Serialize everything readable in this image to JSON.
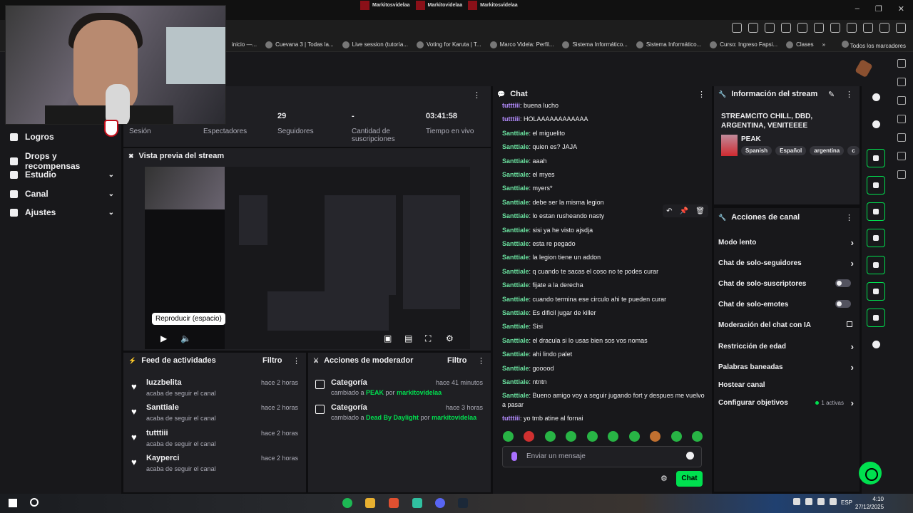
{
  "browser": {
    "tabs": [
      "Markitosvidelaa",
      "Markitovidelaa",
      "Markitosvidelaa"
    ],
    "bookmarks": [
      "inicio —...",
      "Cuevana 3 | Todas la...",
      "Live session (tutoría...",
      "Voting for Karuta | T...",
      "Marco Videla: Perfil...",
      "Sistema Informático...",
      "Sistema Informático...",
      "Curso: Ingreso Fapsi...",
      "Clases"
    ],
    "bookmarks_overflow": "»",
    "all_bookmarks": "Todos los marcadores"
  },
  "nav": {
    "items": [
      {
        "label": "Logros",
        "chev": ""
      },
      {
        "label": "Drops y recompensas",
        "chev": ""
      },
      {
        "label": "Estudio",
        "chev": "⌄"
      },
      {
        "label": "Canal",
        "chev": "⌄"
      },
      {
        "label": "Ajustes",
        "chev": "⌄"
      }
    ]
  },
  "stats": {
    "items": [
      {
        "value": "",
        "label": "Sesión"
      },
      {
        "value": "",
        "label": "Espectadores"
      },
      {
        "value": "29",
        "label": "Seguidores"
      },
      {
        "value": "-",
        "label": "Cantidad de suscripciones"
      },
      {
        "value": "03:41:58",
        "label": "Tiempo en vivo"
      }
    ]
  },
  "preview": {
    "title": "Vista previa del stream",
    "tooltip": "Reproducir (espacio)"
  },
  "feed": {
    "title": "Feed de actividades",
    "filter": "Filtro",
    "items": [
      {
        "name": "luzzbelita",
        "desc": "acaba de seguir el canal",
        "time": "hace 2 horas"
      },
      {
        "name": "Santtiale",
        "desc": "acaba de seguir el canal",
        "time": "hace 2 horas"
      },
      {
        "name": "tutttiii",
        "desc": "acaba de seguir el canal",
        "time": "hace 2 horas"
      },
      {
        "name": "Kayperci",
        "desc": "acaba de seguir el canal",
        "time": "hace 2 horas"
      }
    ]
  },
  "modactions": {
    "title": "Acciones de moderador",
    "filter": "Filtro",
    "items": [
      {
        "name": "Categoría",
        "pre": "cambiado a ",
        "game": "PEAK",
        "mid": " por ",
        "user": "markitovidelaa",
        "time": "hace 41 minutos"
      },
      {
        "name": "Categoría",
        "pre": "cambiado a ",
        "game": "Dead By Daylight",
        "mid": " por ",
        "user": "markitovidelaa",
        "time": "hace 3 horas"
      }
    ]
  },
  "chat": {
    "title": "Chat",
    "messages": [
      {
        "user": "tutttiii",
        "text": "buena lucho",
        "color": "#b48cff"
      },
      {
        "user": "tutttiii",
        "text": "HOLAAAAAAAAAAAA",
        "color": "#b48cff"
      },
      {
        "user": "Santtiale",
        "text": "el miguelito",
        "color": "#6be3a0"
      },
      {
        "user": "Santtiale",
        "text": "quien es? JAJA",
        "color": "#6be3a0"
      },
      {
        "user": "Santtiale",
        "text": "aaah",
        "color": "#6be3a0"
      },
      {
        "user": "Santtiale",
        "text": "el myes",
        "color": "#6be3a0"
      },
      {
        "user": "Santtiale",
        "text": "myers*",
        "color": "#6be3a0"
      },
      {
        "user": "Santtiale",
        "text": "debe ser la misma legion",
        "color": "#6be3a0"
      },
      {
        "user": "Santtiale",
        "text": "lo estan rusheando nasty",
        "color": "#6be3a0"
      },
      {
        "user": "Santtiale",
        "text": "sisi ya he visto ajsdja",
        "color": "#6be3a0"
      },
      {
        "user": "Santtiale",
        "text": "esta re pegado",
        "color": "#6be3a0"
      },
      {
        "user": "Santtiale",
        "text": "la legion tiene un addon",
        "color": "#6be3a0"
      },
      {
        "user": "Santtiale",
        "text": "q cuando te sacas el coso no te podes curar",
        "color": "#6be3a0"
      },
      {
        "user": "Santtiale",
        "text": "fijate a la derecha",
        "color": "#6be3a0"
      },
      {
        "user": "Santtiale",
        "text": "cuando termina ese circulo ahi te pueden curar",
        "color": "#6be3a0"
      },
      {
        "user": "Santtiale",
        "text": "Es dificil jugar de killer",
        "color": "#6be3a0"
      },
      {
        "user": "Santtiale",
        "text": "Sisi",
        "color": "#6be3a0"
      },
      {
        "user": "Santtiale",
        "text": "el dracula si lo usas bien sos vos nomas",
        "color": "#6be3a0"
      },
      {
        "user": "Santtiale",
        "text": "ahi lindo palet",
        "color": "#6be3a0"
      },
      {
        "user": "Santtiale",
        "text": "gooood",
        "color": "#6be3a0"
      },
      {
        "user": "Santtiale",
        "text": "ntntn",
        "color": "#6be3a0"
      },
      {
        "user": "Santtiale",
        "text": "Bueno amigo voy a seguir jugando fort y despues me vuelvo a pasar",
        "color": "#6be3a0"
      },
      {
        "user": "tutttiii",
        "text": "yo tmb atine al fornai",
        "color": "#b48cff"
      }
    ],
    "input_placeholder": "Enviar un mensaje",
    "send_label": "Chat"
  },
  "stream_info": {
    "title": "Información del stream",
    "stream_title": "STREAMCITO CHILL, DBD, ARGENTINA, VENITEEEE",
    "category": "PEAK",
    "tags": [
      "Spanish",
      "Español",
      "argentina",
      "c"
    ]
  },
  "channel_actions": {
    "title": "Acciones de canal",
    "items": [
      {
        "label": "Modo lento",
        "kind": "chevron"
      },
      {
        "label": "Chat de solo-seguidores",
        "kind": "chevron"
      },
      {
        "label": "Chat de solo-suscriptores",
        "kind": "toggle"
      },
      {
        "label": "Chat de solo-emotes",
        "kind": "toggle"
      },
      {
        "label": "Moderación del chat con IA",
        "kind": "external"
      },
      {
        "label": "Restricción de edad",
        "kind": "chevron"
      },
      {
        "label": "Palabras baneadas",
        "kind": "chevron"
      },
      {
        "label": "Hostear canal",
        "kind": "none"
      },
      {
        "label": "Configurar objetivos",
        "kind": "chevron",
        "note": "1 activas"
      }
    ]
  },
  "taskbar": {
    "lang": "ESP",
    "time": "4:10",
    "date": "27/12/2025"
  },
  "colors": {
    "accent": "#00e04f",
    "background": "#0e0e10",
    "panel": "#1f1f23"
  }
}
